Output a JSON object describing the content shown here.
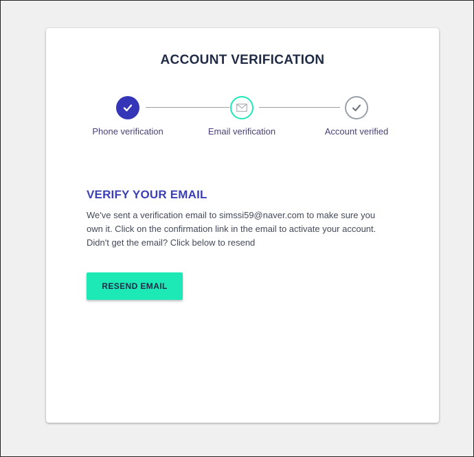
{
  "page": {
    "title": "ACCOUNT VERIFICATION"
  },
  "stepper": {
    "steps": [
      {
        "label": "Phone verification",
        "state": "completed",
        "icon": "check-icon"
      },
      {
        "label": "Email verification",
        "state": "current",
        "icon": "envelope-icon"
      },
      {
        "label": "Account verified",
        "state": "pending",
        "icon": "check-icon"
      }
    ]
  },
  "verify": {
    "heading": "VERIFY YOUR EMAIL",
    "line1": "We've sent a verification email to simssi59@naver.com to make sure you",
    "line2": "own it. Click on the confirmation link in the email to activate your account.",
    "line3": "Didn't get the email? Click below to resend",
    "button_label": "RESEND EMAIL"
  },
  "colors": {
    "completed": "#3535b8",
    "current": "#1de9b6",
    "pending": "#9aa0a8",
    "button": "#1de9b6",
    "heading": "#3b3fb5"
  }
}
